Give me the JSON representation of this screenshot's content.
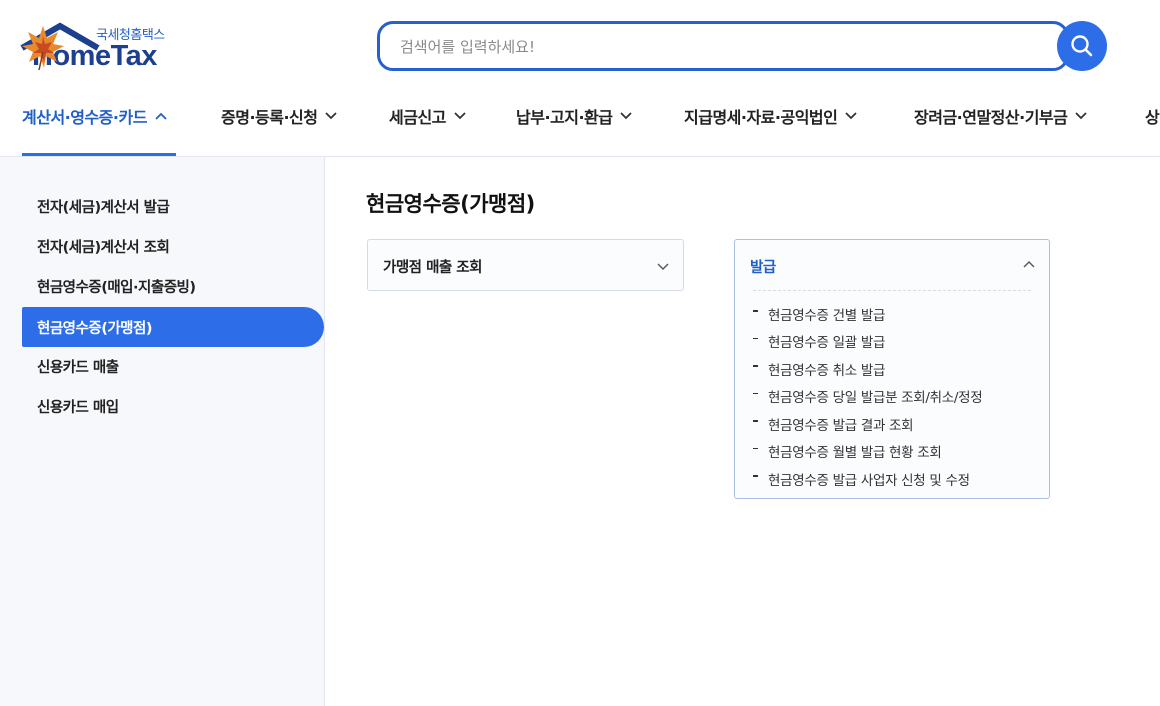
{
  "logo": {
    "sub_label": "국세청홈택스",
    "main_label": "HomeTax"
  },
  "search": {
    "placeholder": "검색어를 입력하세요!"
  },
  "nav": {
    "items": [
      {
        "label": "계산서·영수증·카드",
        "state": "expanded"
      },
      {
        "label": "증명·등록·신청",
        "state": "collapsed"
      },
      {
        "label": "세금신고",
        "state": "collapsed"
      },
      {
        "label": "납부·고지·환급",
        "state": "collapsed"
      },
      {
        "label": "지급명세·자료·공익법인",
        "state": "collapsed"
      },
      {
        "label": "장려금·연말정산·기부금",
        "state": "collapsed"
      },
      {
        "label": "상",
        "state": "cut-off"
      }
    ]
  },
  "sidebar": {
    "items": [
      {
        "label": "전자(세금)계산서 발급"
      },
      {
        "label": "전자(세금)계산서 조회"
      },
      {
        "label": "현금영수증(매입·지출증빙)"
      },
      {
        "label": "현금영수증(가맹점)",
        "active": true
      },
      {
        "label": "신용카드 매출"
      },
      {
        "label": "신용카드 매입"
      }
    ]
  },
  "main": {
    "title": "현금영수증(가맹점)",
    "panels": [
      {
        "title": "가맹점 매출 조회",
        "expanded": false
      },
      {
        "title": "발급",
        "expanded": true,
        "items": [
          "현금영수증 건별 발급",
          "현금영수증 일괄 발급",
          "현금영수증 취소 발급",
          "현금영수증 당일 발급분 조회/취소/정정",
          "현금영수증 발급 결과 조회",
          "현금영수증 월별 발급 현황 조회",
          "현금영수증 발급 사업자 신청 및 수정"
        ]
      }
    ]
  },
  "colors": {
    "accent": "#2d6ee8",
    "accent_text": "#1f5fc8",
    "logo_navy": "#1c3f8f"
  },
  "icons": {
    "search_button": "search-icon",
    "nav_expanded": "chevron-up-icon",
    "nav_collapsed": "chevron-down-icon",
    "logo_decoration": "maple-leaf-icon"
  }
}
